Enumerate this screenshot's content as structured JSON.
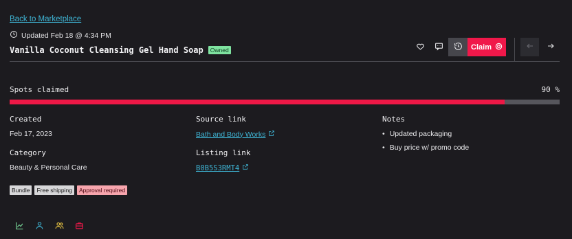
{
  "header": {
    "back_link": "Back to Marketplace",
    "updated": "Updated Feb 18 @ 4:34 PM",
    "title": "Vanilla Coconut Cleansing Gel Hand Soap",
    "owned_badge": "Owned"
  },
  "actions": {
    "claim_label": "Claim"
  },
  "spots": {
    "label": "Spots claimed",
    "value": "90 %",
    "fraction": 0.9
  },
  "details": {
    "created_label": "Created",
    "created_value": "Feb 17, 2023",
    "category_label": "Category",
    "category_value": "Beauty & Personal Care",
    "source_label": "Source link",
    "source_value": "Bath and Body Works",
    "listing_label": "Listing link",
    "listing_value": "B0B5S3RMT4",
    "notes_label": "Notes",
    "notes": [
      "Updated packaging",
      "Buy price w/ promo code"
    ]
  },
  "tags": [
    "Bundle",
    "Free shipping",
    "Approval required"
  ],
  "colors": {
    "background": "#1c1b1f",
    "accent": "#f0184a",
    "link": "#3fb6d6",
    "owned": "#7fe3a0"
  },
  "icons": {
    "bottom": [
      "chart-icon",
      "user-icon",
      "users-icon",
      "briefcase-icon"
    ]
  }
}
